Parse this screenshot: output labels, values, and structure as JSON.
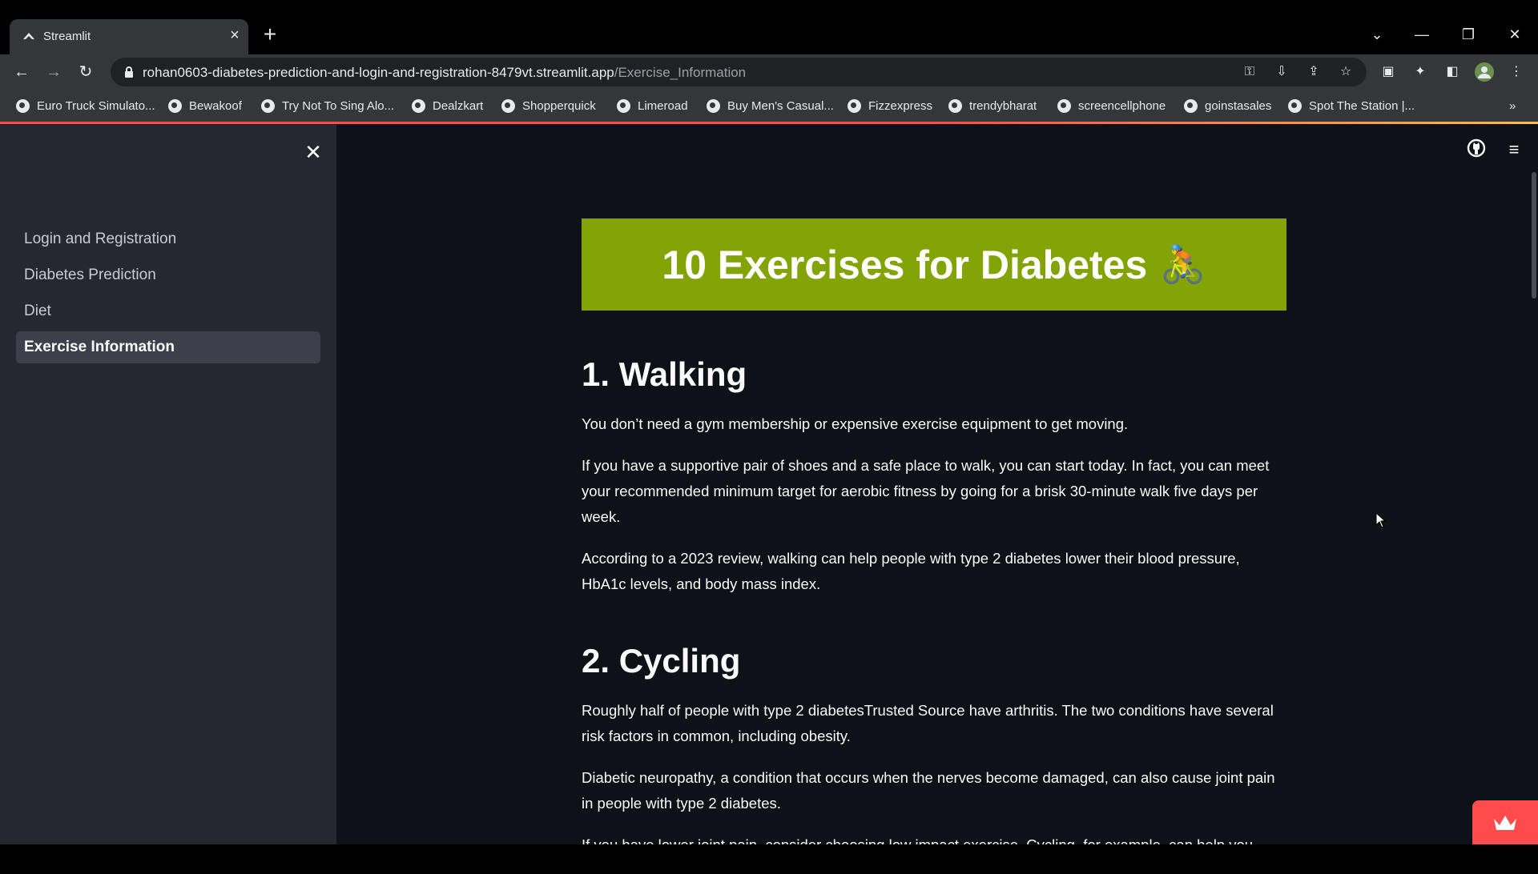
{
  "browser": {
    "tab_title": "Streamlit",
    "new_tab_symbol": "+",
    "url_host": "rohan0603-diabetes-prediction-and-login-and-registration-8479vt.streamlit.app",
    "url_path": "/Exercise_Information",
    "bookmarks": [
      {
        "label": "Euro Truck Simulato..."
      },
      {
        "label": "Bewakoof"
      },
      {
        "label": "Try Not To Sing Alo..."
      },
      {
        "label": "Dealzkart"
      },
      {
        "label": "Shopperquick"
      },
      {
        "label": "Limeroad"
      },
      {
        "label": "Buy Men's Casual..."
      },
      {
        "label": "Fizzexpress"
      },
      {
        "label": "trendybharat"
      },
      {
        "label": "screencellphone"
      },
      {
        "label": "goinstasales"
      },
      {
        "label": "Spot The Station |..."
      }
    ],
    "overflow": "»"
  },
  "sidebar": {
    "items": [
      {
        "label": "Login and Registration"
      },
      {
        "label": "Diabetes Prediction"
      },
      {
        "label": "Diet"
      },
      {
        "label": "Exercise Information"
      }
    ]
  },
  "main": {
    "banner_title": "10 Exercises for Diabetes",
    "banner_emoji": "🚴",
    "sections": [
      {
        "heading": "1. Walking",
        "paragraphs": [
          "You don’t need a gym membership or expensive exercise equipment to get moving.",
          "If you have a supportive pair of shoes and a safe place to walk, you can start today. In fact, you can meet your recommended minimum target for aerobic fitness by going for a brisk 30-minute walk five days per week.",
          "According to a 2023 review, walking can help people with type 2 diabetes lower their blood pressure, HbA1c levels, and body mass index."
        ]
      },
      {
        "heading": "2. Cycling",
        "paragraphs": [
          "Roughly half of people with type 2 diabetesTrusted Source have arthritis. The two conditions have several risk factors in common, including obesity.",
          "Diabetic neuropathy, a condition that occurs when the nerves become damaged, can also cause joint pain in people with type 2 diabetes.",
          "If you have lower joint pain, consider choosing low impact exercise. Cycling, for example, can help you"
        ]
      }
    ]
  },
  "colors": {
    "app_bg": "#0e1117",
    "sidebar_bg": "#262730",
    "banner_bg": "#83a306",
    "accent": "#ff4b4b"
  }
}
